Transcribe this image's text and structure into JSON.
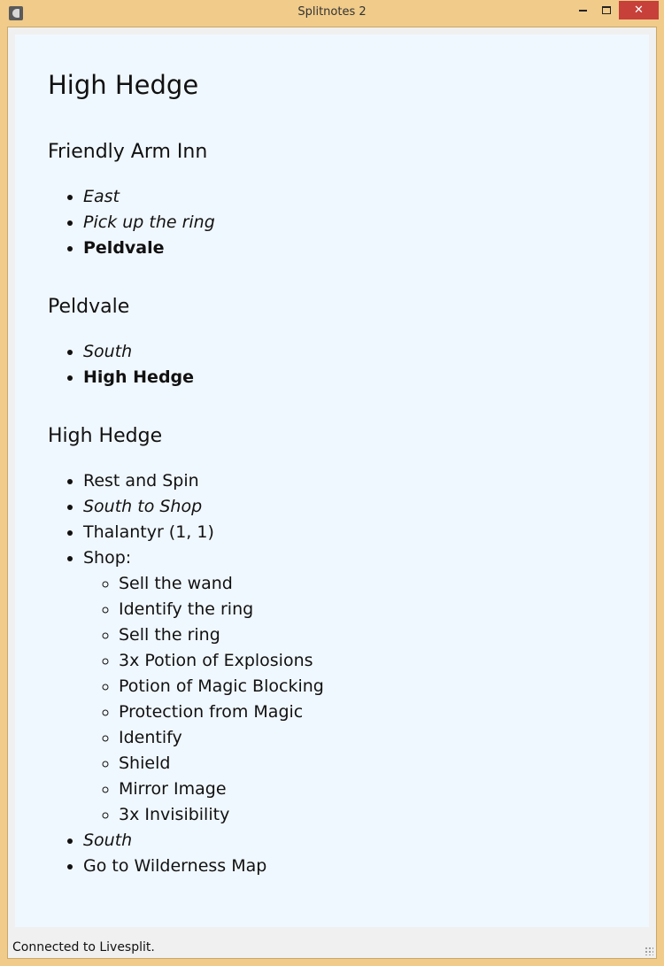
{
  "window": {
    "title": "Splitnotes 2",
    "close_glyph": "✕"
  },
  "colors": {
    "titlebar": "#f0cb8a",
    "notes_background": "#f0f8ff",
    "close_button": "#c7403a"
  },
  "icons": [
    "app-icon",
    "minimize-icon",
    "maximize-icon",
    "close-icon",
    "resize-grip-icon"
  ],
  "notes": {
    "title": "High Hedge",
    "sections": [
      {
        "heading": "Friendly Arm Inn",
        "items": [
          {
            "text": "East",
            "style": "italic"
          },
          {
            "text": "Pick up the ring",
            "style": "italic"
          },
          {
            "text": "Peldvale",
            "style": "bold"
          }
        ]
      },
      {
        "heading": "Peldvale",
        "items": [
          {
            "text": "South",
            "style": "italic"
          },
          {
            "text": "High Hedge",
            "style": "bold"
          }
        ]
      },
      {
        "heading": "High Hedge",
        "items": [
          {
            "text": "Rest and Spin",
            "style": "normal"
          },
          {
            "text": "South to Shop",
            "style": "italic"
          },
          {
            "text": "Thalantyr (1, 1)",
            "style": "normal"
          },
          {
            "text": "Shop:",
            "style": "normal",
            "subitems": [
              "Sell the wand",
              "Identify the ring",
              "Sell the ring",
              "3x Potion of Explosions",
              "Potion of Magic Blocking",
              "Protection from Magic",
              "Identify",
              "Shield",
              "Mirror Image",
              "3x Invisibility"
            ]
          },
          {
            "text": "South",
            "style": "italic"
          },
          {
            "text": "Go to Wilderness Map",
            "style": "normal"
          }
        ]
      }
    ]
  },
  "status": {
    "text": "Connected to Livesplit."
  }
}
